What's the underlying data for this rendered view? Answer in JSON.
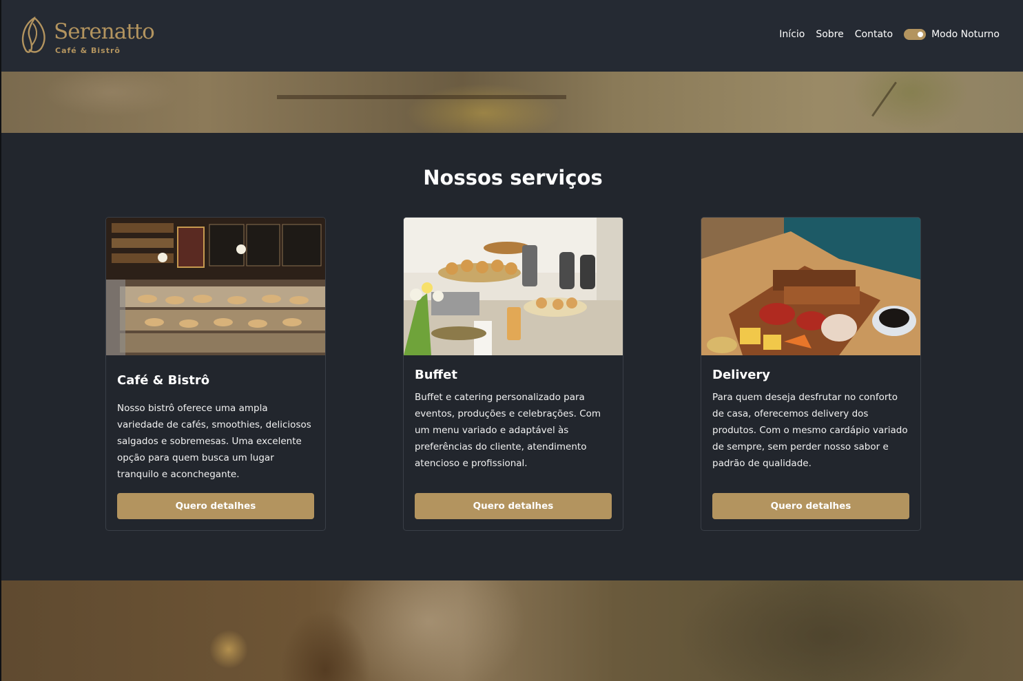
{
  "brand": {
    "name": "Serenatto",
    "tagline": "Café & Bistrô",
    "accent_color": "#b3945f"
  },
  "nav": {
    "items": [
      "Início",
      "Sobre",
      "Contato"
    ],
    "mode_label": "Modo Noturno",
    "mode_on": true
  },
  "services": {
    "title": "Nossos serviços",
    "cards": [
      {
        "title": "Café & Bistrô",
        "text": "Nosso bistrô oferece uma ampla variedade de cafés, smoothies, deliciosos salgados e sobremesas. Uma excelente opção para quem busca um lugar tranquilo e aconchegante.",
        "button": "Quero detalhes",
        "image": "cafe-counter-photo"
      },
      {
        "title": "Buffet",
        "text": "Buffet e catering personalizado para eventos, produções e celebrações. Com um menu variado e adaptável às preferências do cliente, atendimento atencioso e profissional.",
        "button": "Quero detalhes",
        "image": "buffet-table-photo"
      },
      {
        "title": "Delivery",
        "text": "Para quem deseja desfrutar no conforto de casa, oferecemos delivery dos produtos. Com o mesmo cardápio variado de sempre, sem perder nosso sabor e padrão de qualidade.",
        "button": "Quero detalhes",
        "image": "delivery-box-photo"
      }
    ]
  },
  "colors": {
    "background": "#22262d",
    "header": "#252a33",
    "button": "#b3945f"
  }
}
